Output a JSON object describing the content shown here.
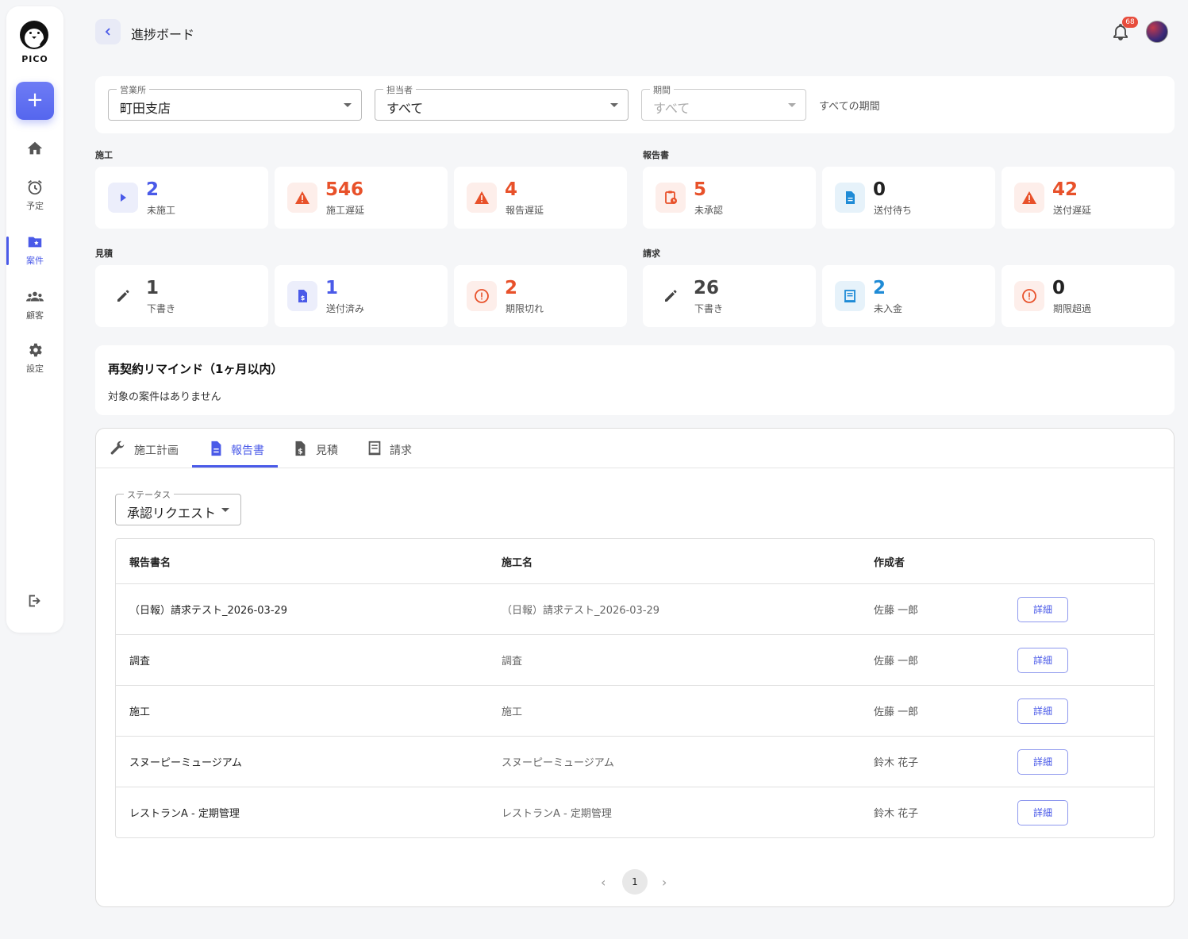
{
  "app": {
    "logo_text": "PICO",
    "add_label": "+"
  },
  "nav": [
    {
      "name": "home",
      "label": ""
    },
    {
      "name": "schedule",
      "label": "予定"
    },
    {
      "name": "cases",
      "label": "案件"
    },
    {
      "name": "customers",
      "label": "顧客"
    },
    {
      "name": "settings",
      "label": "設定"
    }
  ],
  "header": {
    "title": "進捗ボード",
    "notification_count": "68"
  },
  "filters": {
    "office": {
      "label": "営業所",
      "value": "町田支店"
    },
    "assignee": {
      "label": "担当者",
      "value": "すべて"
    },
    "period": {
      "label": "期間",
      "value": "すべて"
    },
    "period_text": "すべての期間"
  },
  "sections": {
    "construction": "施工",
    "report": "報告書",
    "estimate": "見積",
    "invoice": "請求"
  },
  "stats": {
    "construction": [
      {
        "value": "2",
        "label": "未施工"
      },
      {
        "value": "546",
        "label": "施工遅延"
      },
      {
        "value": "4",
        "label": "報告遅延"
      }
    ],
    "report": [
      {
        "value": "5",
        "label": "未承認"
      },
      {
        "value": "0",
        "label": "送付待ち"
      },
      {
        "value": "42",
        "label": "送付遅延"
      }
    ],
    "estimate": [
      {
        "value": "1",
        "label": "下書き"
      },
      {
        "value": "1",
        "label": "送付済み"
      },
      {
        "value": "2",
        "label": "期限切れ"
      }
    ],
    "invoice": [
      {
        "value": "26",
        "label": "下書き"
      },
      {
        "value": "2",
        "label": "未入金"
      },
      {
        "value": "0",
        "label": "期限超過"
      }
    ]
  },
  "remind": {
    "title": "再契約リマインド（1ヶ月以内）",
    "empty": "対象の案件はありません"
  },
  "tabs": [
    {
      "label": "施工計画"
    },
    {
      "label": "報告書"
    },
    {
      "label": "見積"
    },
    {
      "label": "請求"
    }
  ],
  "status_filter": {
    "label": "ステータス",
    "value": "承認リクエスト"
  },
  "table": {
    "headers": [
      "報告書名",
      "施工名",
      "作成者"
    ],
    "detail_label": "詳細",
    "rows": [
      {
        "report": "（日報）請求テスト_2026-03-29",
        "construction": "（日報）請求テスト_2026-03-29",
        "author": "佐藤 一郎"
      },
      {
        "report": "調査",
        "construction": "調査",
        "author": "佐藤 一郎"
      },
      {
        "report": "施工",
        "construction": "施工",
        "author": "佐藤 一郎"
      },
      {
        "report": "スヌーピーミュージアム",
        "construction": "スヌーピーミュージアム",
        "author": "鈴木 花子"
      },
      {
        "report": "レストランA - 定期管理",
        "construction": "レストランA - 定期管理",
        "author": "鈴木 花子"
      }
    ]
  },
  "pagination": {
    "current": "1"
  },
  "colors": {
    "accent": "#4a5ae8",
    "danger": "#e8512a",
    "info": "#1f8bd6"
  }
}
